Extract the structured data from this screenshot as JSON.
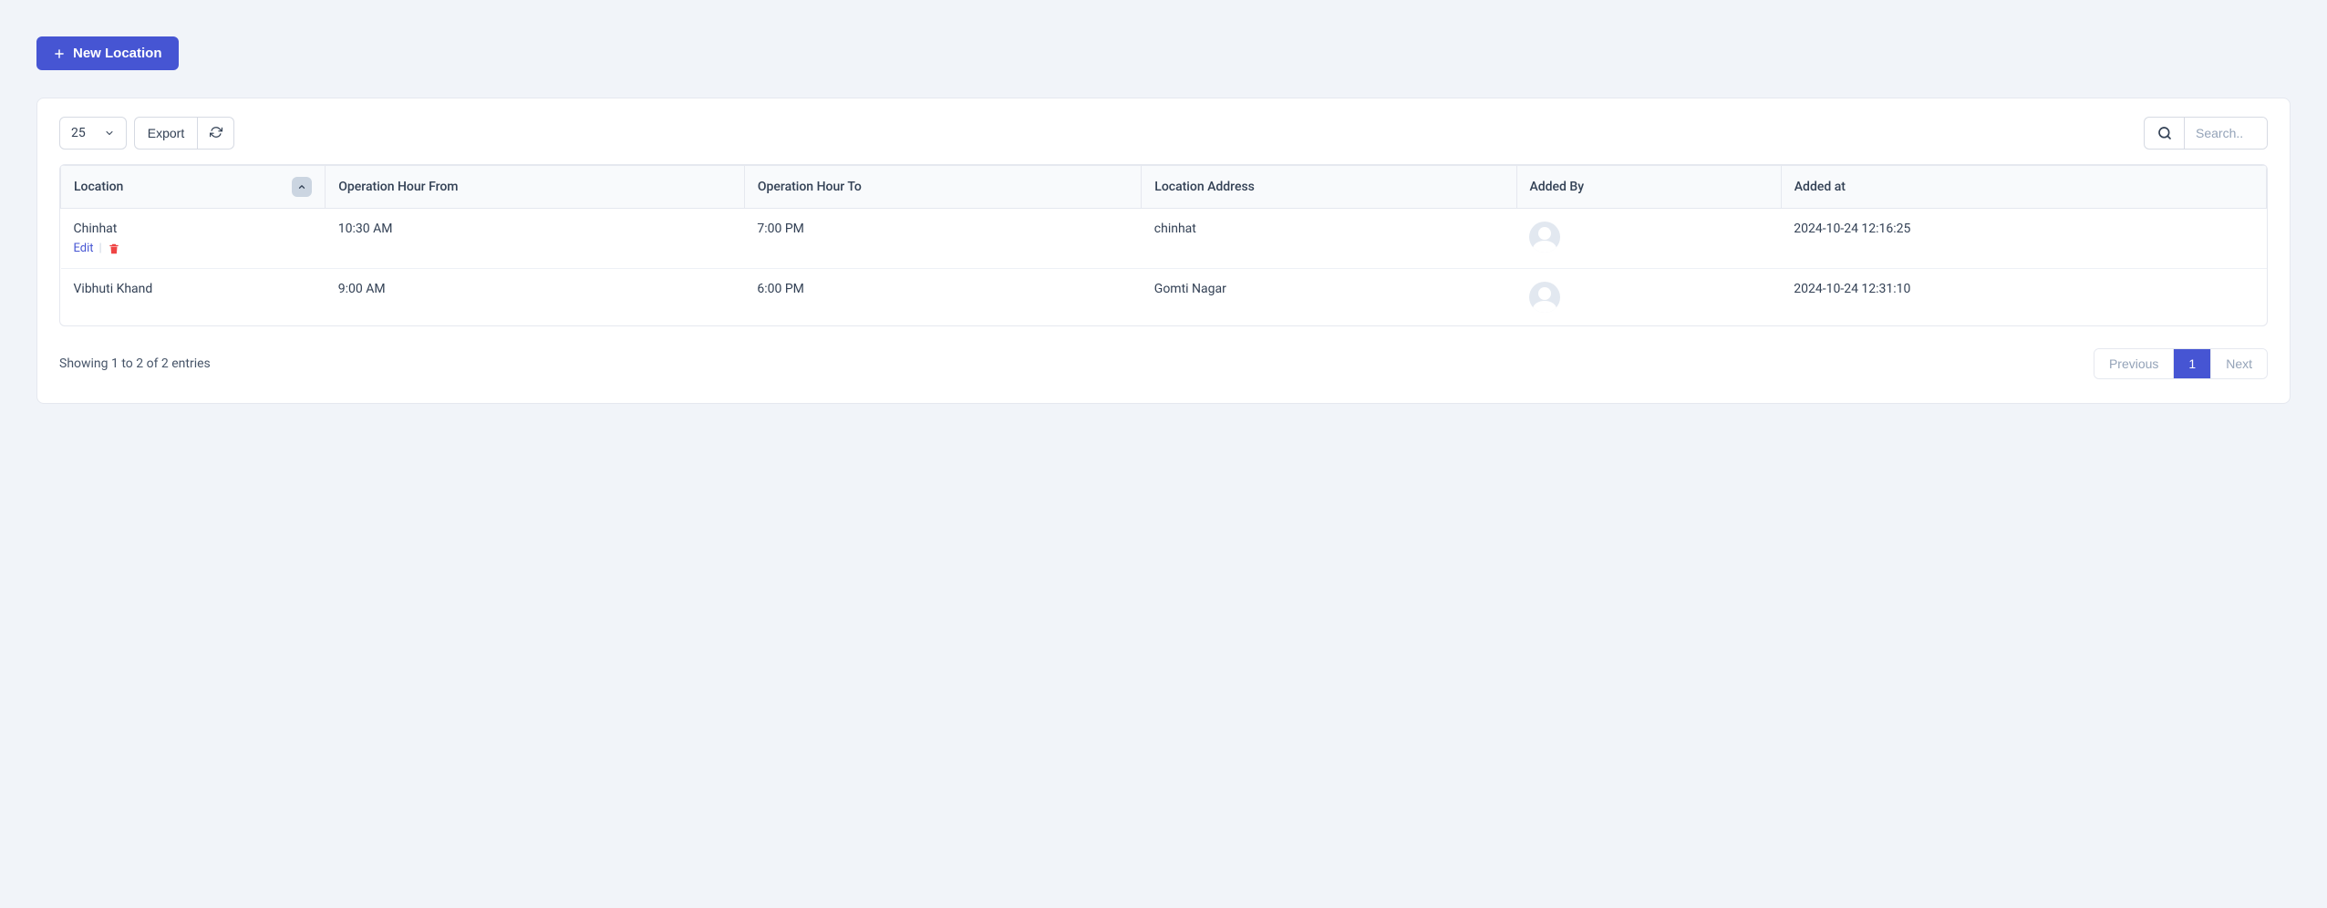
{
  "header": {
    "new_location_label": "New Location"
  },
  "toolbar": {
    "page_size": "25",
    "export_label": "Export",
    "search_placeholder": "Search.."
  },
  "columns": {
    "location": "Location",
    "hour_from": "Operation Hour From",
    "hour_to": "Operation Hour To",
    "address": "Location Address",
    "added_by": "Added By",
    "added_at": "Added at"
  },
  "rows": [
    {
      "location": "Chinhat",
      "hour_from": "10:30 AM",
      "hour_to": "7:00 PM",
      "address": "chinhat",
      "added_at": "2024-10-24 12:16:25",
      "show_actions": true
    },
    {
      "location": "Vibhuti Khand",
      "hour_from": "9:00 AM",
      "hour_to": "6:00 PM",
      "address": "Gomti Nagar",
      "added_at": "2024-10-24 12:31:10",
      "show_actions": false
    }
  ],
  "row_actions": {
    "edit_label": "Edit"
  },
  "footer": {
    "entries_text": "Showing 1 to 2 of 2 entries",
    "prev_label": "Previous",
    "next_label": "Next",
    "page_1": "1"
  }
}
